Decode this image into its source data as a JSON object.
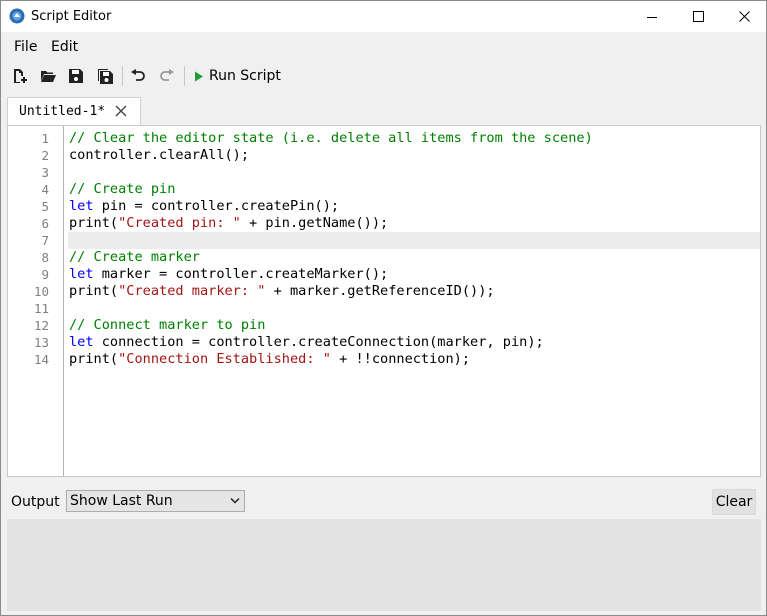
{
  "window": {
    "title": "Script Editor"
  },
  "menu": {
    "items": [
      "File",
      "Edit"
    ]
  },
  "toolbar": {
    "run_label": "Run Script"
  },
  "tab": {
    "label": "Untitled-1*"
  },
  "editor": {
    "current_line": 7,
    "line_numbers": [
      "1",
      "2",
      "3",
      "4",
      "5",
      "6",
      "7",
      "8",
      "9",
      "10",
      "11",
      "12",
      "13",
      "14"
    ],
    "lines": [
      {
        "segments": [
          {
            "t": "// Clear the editor state (i.e. delete all items from the scene)",
            "c": "cm"
          }
        ]
      },
      {
        "segments": [
          {
            "t": "controller.clearAll();",
            "c": ""
          }
        ]
      },
      {
        "segments": []
      },
      {
        "segments": [
          {
            "t": "// Create pin",
            "c": "cm"
          }
        ]
      },
      {
        "segments": [
          {
            "t": "let",
            "c": "kw"
          },
          {
            "t": " pin = controller.createPin();",
            "c": ""
          }
        ]
      },
      {
        "segments": [
          {
            "t": "print(",
            "c": ""
          },
          {
            "t": "\"Created pin: \"",
            "c": "str"
          },
          {
            "t": " + pin.getName());",
            "c": ""
          }
        ]
      },
      {
        "segments": []
      },
      {
        "segments": [
          {
            "t": "// Create marker",
            "c": "cm"
          }
        ]
      },
      {
        "segments": [
          {
            "t": "let",
            "c": "kw"
          },
          {
            "t": " marker = controller.createMarker();",
            "c": ""
          }
        ]
      },
      {
        "segments": [
          {
            "t": "print(",
            "c": ""
          },
          {
            "t": "\"Created marker: \"",
            "c": "str"
          },
          {
            "t": " + marker.getReferenceID());",
            "c": ""
          }
        ]
      },
      {
        "segments": []
      },
      {
        "segments": [
          {
            "t": "// Connect marker to pin",
            "c": "cm"
          }
        ]
      },
      {
        "segments": [
          {
            "t": "let",
            "c": "kw"
          },
          {
            "t": " connection = controller.createConnection(marker, pin);",
            "c": ""
          }
        ]
      },
      {
        "segments": [
          {
            "t": "print(",
            "c": ""
          },
          {
            "t": "\"Connection Established: \"",
            "c": "str"
          },
          {
            "t": " + !!connection);",
            "c": ""
          }
        ]
      }
    ]
  },
  "output": {
    "label": "Output",
    "selected": "Show Last Run",
    "clear_label": "Clear"
  },
  "colors": {
    "comment": "#008000",
    "keyword": "#0000ff",
    "string": "#a31515",
    "run_icon": "#1e9e3a",
    "app_icon": "#2b6cb0"
  }
}
